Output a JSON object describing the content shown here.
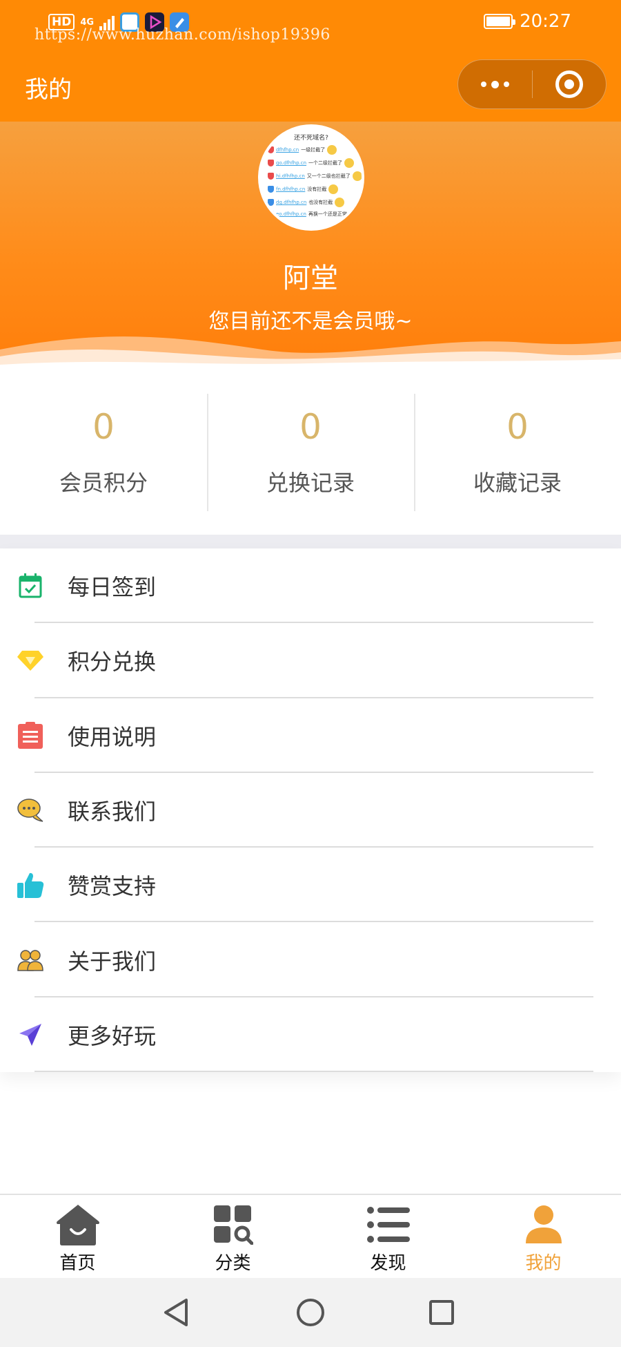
{
  "status_bar": {
    "hd": "HD",
    "network": "4G",
    "time": "20:27",
    "battery_level": 0.95,
    "watermark": "https://www.huzhan.com/ishop19396"
  },
  "header": {
    "title": "我的",
    "capsule": {
      "more_icon": "dots-icon",
      "close_icon": "target-icon"
    },
    "background_color": "#ff8a05"
  },
  "profile": {
    "name": "阿堂",
    "member_note": "您目前还不是会员哦~",
    "avatar": {
      "title": "还不死域名?",
      "lines": [
        {
          "link": "dfhfhp.cn",
          "text": "一级拦截了",
          "shield": "#e94b4b"
        },
        {
          "link": "go.dfhfhp.cn",
          "text": "一个二级拦截了",
          "shield": "#e94b4b"
        },
        {
          "link": "hi.dfhfhp.cn",
          "text": "又一个二级也拦截了",
          "shield": "#e94b4b"
        },
        {
          "link": "fn.dfhfhp.cn",
          "text": "没有拦截",
          "shield": "#3a8ee6"
        },
        {
          "link": "dg.dfhfhp.cn",
          "text": "也没有拦截",
          "shield": "#3a8ee6"
        },
        {
          "link": "eo.dfhfhp.cn",
          "text": "再换一个还是正常",
          "shield": "#3a8ee6"
        }
      ]
    }
  },
  "stats": [
    {
      "value": "0",
      "label": "会员积分"
    },
    {
      "value": "0",
      "label": "兑换记录"
    },
    {
      "value": "0",
      "label": "收藏记录"
    }
  ],
  "menu": [
    {
      "label": "每日签到",
      "icon": "calendar-check-icon",
      "color": "#19b36b"
    },
    {
      "label": "积分兑换",
      "icon": "diamond-icon",
      "color": "#ffd22a"
    },
    {
      "label": "使用说明",
      "icon": "document-icon",
      "color": "#f0605a"
    },
    {
      "label": "联系我们",
      "icon": "chat-bubble-icon",
      "color": "#f2bf3c"
    },
    {
      "label": "赞赏支持",
      "icon": "thumbs-up-icon",
      "color": "#27c0d6"
    },
    {
      "label": "关于我们",
      "icon": "users-icon",
      "color": "#f0b43a"
    },
    {
      "label": "更多好玩",
      "icon": "paper-plane-icon",
      "color": "#6a4ee8"
    }
  ],
  "tabbar": [
    {
      "label": "首页",
      "icon": "home-icon",
      "active": false
    },
    {
      "label": "分类",
      "icon": "category-icon",
      "active": false
    },
    {
      "label": "发现",
      "icon": "list-icon",
      "active": false
    },
    {
      "label": "我的",
      "icon": "person-icon",
      "active": true
    }
  ],
  "colors": {
    "accent": "#f0a23a",
    "stat_value": "#d8b56a",
    "tab_inactive": "#555555"
  },
  "system_nav": {
    "back": "back-triangle-icon",
    "home": "home-circle-icon",
    "recents": "recents-square-icon"
  }
}
